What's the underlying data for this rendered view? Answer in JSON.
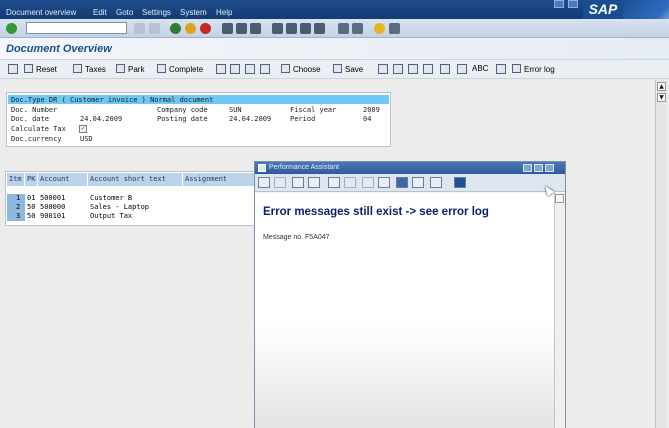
{
  "menu": [
    "Document overview",
    "Edit",
    "Goto",
    "Settings",
    "System",
    "Help"
  ],
  "brand": "SAP",
  "title": "Document Overview",
  "app_toolbar": {
    "reset": "Reset",
    "taxes": "Taxes",
    "park": "Park",
    "complete": "Complete",
    "choose": "Choose",
    "save": "Save",
    "abc": "ABC",
    "error_log": "Error log"
  },
  "header": {
    "doc_type_line": "Doc.Type   DR ( Customer invoice ) Normal document",
    "doc_number_label": "Doc. Number",
    "company_code_label": "Company code",
    "company_code": "SUN",
    "fiscal_year_label": "Fiscal year",
    "fiscal_year": "2009",
    "doc_date_label": "Doc. date",
    "doc_date": "24.04.2009",
    "posting_date_label": "Posting date",
    "posting_date": "24.04.2009",
    "period_label": "Period",
    "period": "04",
    "calc_tax_label": "Calculate Tax",
    "currency_label": "Doc.currency",
    "currency": "USD"
  },
  "table": {
    "columns": [
      "Itm",
      "PK",
      "Account",
      "Account short text",
      "Assignment"
    ],
    "rows": [
      {
        "itm": "1",
        "pk": "01",
        "account": "500001",
        "text": "Customer B"
      },
      {
        "itm": "2",
        "pk": "50",
        "account": "500000",
        "text": "Sales - Laptop"
      },
      {
        "itm": "3",
        "pk": "50",
        "account": "900101",
        "text": "Output Tax"
      }
    ]
  },
  "assistant": {
    "title": "Performance Assistant",
    "error": "Error messages still exist -> see error log",
    "message_no": "Message no. F5A047"
  }
}
